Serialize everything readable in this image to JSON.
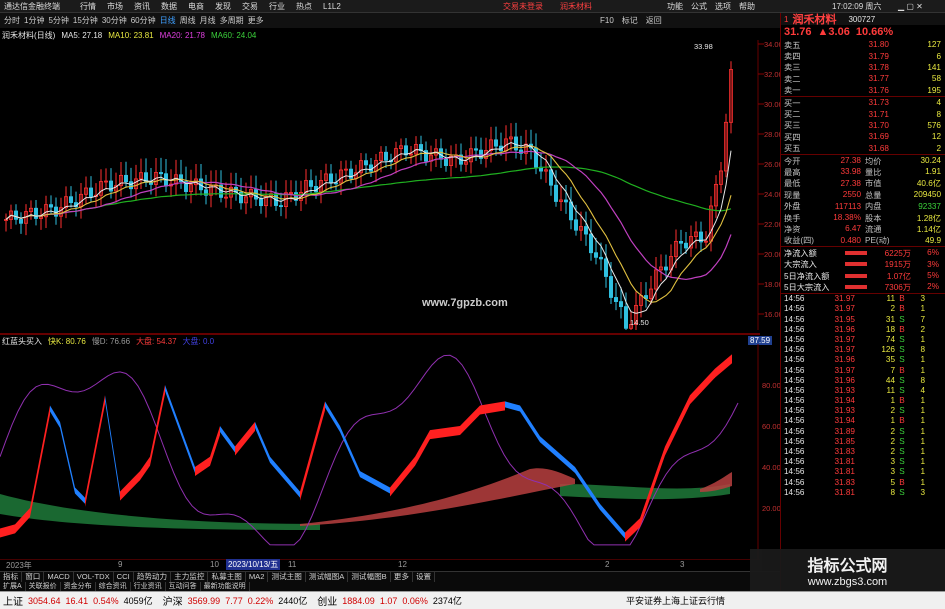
{
  "titlebar": {
    "app_title": "通达信金融终端",
    "menu": [
      "行情",
      "市场",
      "资讯",
      "数据",
      "电商",
      "发现",
      "交易",
      "行业",
      "热点",
      "L1L2"
    ],
    "login": "交易未登录",
    "stock_tab": "润禾材料",
    "right_menu": [
      "功能",
      "公式",
      "选项",
      "帮助"
    ],
    "time": "17:02:09 周六",
    "hdr_tools": [
      "F10",
      "标记",
      "返回"
    ]
  },
  "periodbar": {
    "periods": [
      "分时",
      "1分钟",
      "5分钟",
      "15分钟",
      "30分钟",
      "60分钟",
      "日线",
      "周线",
      "月线",
      "多周期",
      "更多"
    ]
  },
  "ma_legend": {
    "label": "润禾材料(日线)",
    "ma5": "MA5: 27.18",
    "ma10": "MA10: 23.81",
    "ma20": "MA20: 21.78",
    "ma60": "MA60: 24.04"
  },
  "price_axis": [
    "34.00",
    "32.00",
    "30.00",
    "28.00",
    "26.00",
    "24.00",
    "22.00",
    "20.00",
    "18.00",
    "16.00"
  ],
  "price_marks": {
    "high": "33.98",
    "low": "14.50"
  },
  "site_watermark": "www.7gpzb.com",
  "indicator": {
    "name": "红蓝头买入",
    "fast_label": "快K: 80.76",
    "slow_label": "慢D: 76.66",
    "big_label": "大盘: 54.37",
    "extra_label": "大盘: 0.0",
    "right_value": "87.59",
    "axis": [
      "80.00",
      "60.00",
      "40.00",
      "20.00"
    ]
  },
  "date_axis": [
    "2023年",
    "9",
    "10",
    "11",
    "12",
    "2",
    "3"
  ],
  "date_cursor": "2023/10/13/五",
  "bottom_tabs": [
    "指标",
    "窗口",
    "MACD",
    "VOL-TDX",
    "CCI",
    "趋势动力",
    "主力监控",
    "私募主图",
    "MA2",
    "测试主图",
    "测试幅图A",
    "测试幅图B",
    "更多",
    "设置"
  ],
  "bottom_tabs2": [
    "扩展A",
    "关联报价",
    "资金分布",
    "综合资讯",
    "行业资讯",
    "互动问答",
    "最新功能说明"
  ],
  "quote": {
    "name": "润禾材料",
    "code": "300727",
    "price": "31.76",
    "change": "▲3.06",
    "pct": "10.66%",
    "asks": [
      {
        "label": "卖五",
        "price": "31.80",
        "vol": "127"
      },
      {
        "label": "卖四",
        "price": "31.79",
        "vol": "6"
      },
      {
        "label": "卖三",
        "price": "31.78",
        "vol": "141"
      },
      {
        "label": "卖二",
        "price": "31.77",
        "vol": "58"
      },
      {
        "label": "卖一",
        "price": "31.76",
        "vol": "195"
      }
    ],
    "bids": [
      {
        "label": "买一",
        "price": "31.73",
        "vol": "4"
      },
      {
        "label": "买二",
        "price": "31.71",
        "vol": "8"
      },
      {
        "label": "买三",
        "price": "31.70",
        "vol": "576"
      },
      {
        "label": "买四",
        "price": "31.69",
        "vol": "12"
      },
      {
        "label": "买五",
        "price": "31.68",
        "vol": "2"
      }
    ],
    "stats": [
      {
        "k1": "今开",
        "v1": "27.38",
        "k2": "均价",
        "v2": "30.24"
      },
      {
        "k1": "最高",
        "v1": "33.98",
        "k2": "量比",
        "v2": "1.91"
      },
      {
        "k1": "最低",
        "v1": "27.38",
        "k2": "市值",
        "v2": "40.6亿"
      },
      {
        "k1": "现量",
        "v1": "2550",
        "k2": "总量",
        "v2": "209450"
      },
      {
        "k1": "外盘",
        "v1": "117113",
        "k2": "内盘",
        "v2": "92337"
      },
      {
        "k1": "换手",
        "v1": "18.38%",
        "k2": "股本",
        "v2": "1.28亿"
      },
      {
        "k1": "净资",
        "v1": "6.47",
        "k2": "流通",
        "v2": "1.14亿"
      },
      {
        "k1": "收益(四)",
        "v1": "0.480",
        "k2": "PE(动)",
        "v2": "49.9"
      }
    ],
    "flows": [
      {
        "k": "净流入额",
        "v": "6225万",
        "p": "6%"
      },
      {
        "k": "大宗流入",
        "v": "1915万",
        "p": "3%"
      },
      {
        "k": "5日净流入额",
        "v": "1.07亿",
        "p": "5%"
      },
      {
        "k": "5日大宗流入",
        "v": "7306万",
        "p": "2%"
      }
    ],
    "ticks": [
      {
        "t": "14:56",
        "p": "31.97",
        "v": "11",
        "s": "B",
        "n": "3"
      },
      {
        "t": "14:56",
        "p": "31.97",
        "v": "2",
        "s": "B",
        "n": "1"
      },
      {
        "t": "14:56",
        "p": "31.95",
        "v": "31",
        "s": "S",
        "n": "7"
      },
      {
        "t": "14:56",
        "p": "31.96",
        "v": "18",
        "s": "B",
        "n": "2"
      },
      {
        "t": "14:56",
        "p": "31.97",
        "v": "74",
        "s": "S",
        "n": "1"
      },
      {
        "t": "14:56",
        "p": "31.97",
        "v": "126",
        "s": "S",
        "n": "8"
      },
      {
        "t": "14:56",
        "p": "31.96",
        "v": "35",
        "s": "S",
        "n": "1"
      },
      {
        "t": "14:56",
        "p": "31.97",
        "v": "7",
        "s": "B",
        "n": "1"
      },
      {
        "t": "14:56",
        "p": "31.96",
        "v": "44",
        "s": "S",
        "n": "8"
      },
      {
        "t": "14:56",
        "p": "31.93",
        "v": "11",
        "s": "S",
        "n": "4"
      },
      {
        "t": "14:56",
        "p": "31.94",
        "v": "1",
        "s": "B",
        "n": "1"
      },
      {
        "t": "14:56",
        "p": "31.93",
        "v": "2",
        "s": "S",
        "n": "1"
      },
      {
        "t": "14:56",
        "p": "31.94",
        "v": "1",
        "s": "B",
        "n": "1"
      },
      {
        "t": "14:56",
        "p": "31.89",
        "v": "2",
        "s": "S",
        "n": "1"
      },
      {
        "t": "14:56",
        "p": "31.85",
        "v": "2",
        "s": "S",
        "n": "1"
      },
      {
        "t": "14:56",
        "p": "31.83",
        "v": "2",
        "s": "S",
        "n": "1"
      },
      {
        "t": "14:56",
        "p": "31.81",
        "v": "3",
        "s": "S",
        "n": "1"
      },
      {
        "t": "14:56",
        "p": "31.81",
        "v": "3",
        "s": "S",
        "n": "1"
      },
      {
        "t": "14:56",
        "p": "31.83",
        "v": "5",
        "s": "B",
        "n": "1"
      },
      {
        "t": "14:56",
        "p": "31.81",
        "v": "8",
        "s": "S",
        "n": "3"
      }
    ]
  },
  "statusbar": {
    "items": [
      {
        "name": "上证",
        "val": "3054.64",
        "chg": "16.41",
        "pct": "0.54%",
        "amt": "4059亿"
      },
      {
        "name": "沪深",
        "val": "3569.99",
        "chg": "7.77",
        "pct": "0.22%",
        "amt": "2440亿"
      },
      {
        "name": "创业",
        "val": "1884.09",
        "chg": "1.07",
        "pct": "0.06%",
        "amt": "2374亿"
      }
    ],
    "broker": "平安证券上海上证云行情"
  },
  "corner_watermark": {
    "title": "指标公式网",
    "url": "www.zbgs3.com"
  }
}
